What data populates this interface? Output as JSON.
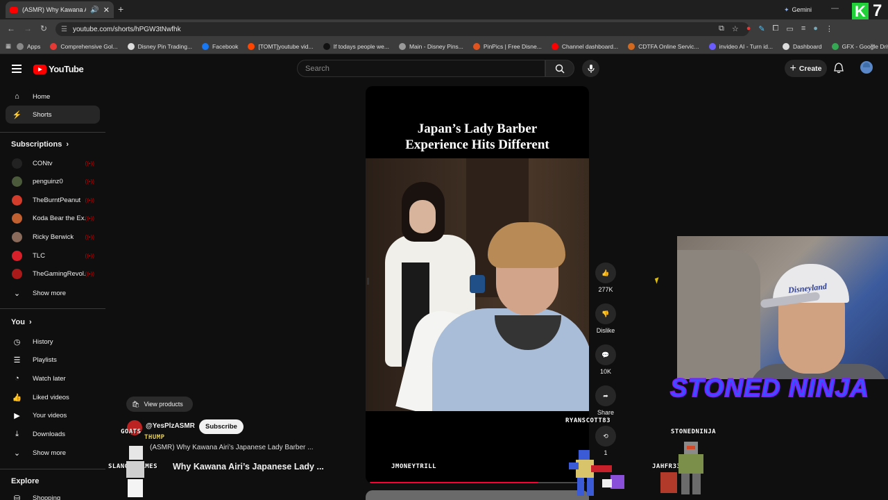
{
  "browser": {
    "tab_title": "(ASMR) Why Kawana Ai",
    "new_tab": "+",
    "url": "youtube.com/shorts/hPGW3tNwfhk",
    "gemini_label": "Gemini",
    "corner_badge": "K",
    "corner_number": "7",
    "bookmarks": [
      {
        "label": "Apps",
        "color": "#888888"
      },
      {
        "label": "Comprehensive Gol...",
        "color": "#e53935"
      },
      {
        "label": "Disney Pin Trading...",
        "color": "#dddddd"
      },
      {
        "label": "Facebook",
        "color": "#1877f2"
      },
      {
        "label": "[TOMT]youtube vid...",
        "color": "#ff4500"
      },
      {
        "label": "If todays people we...",
        "color": "#111111"
      },
      {
        "label": "Main - Disney Pins...",
        "color": "#999999"
      },
      {
        "label": "PinPics | Free Disne...",
        "color": "#e0531f"
      },
      {
        "label": "Channel dashboard...",
        "color": "#ff0000"
      },
      {
        "label": "CDTFA Online Servic...",
        "color": "#d2691e"
      },
      {
        "label": "invideo AI - Turn id...",
        "color": "#6b5cff"
      },
      {
        "label": "Dashboard",
        "color": "#dddddd"
      },
      {
        "label": "GFX - Google Drive",
        "color": "#34a853"
      }
    ]
  },
  "youtube": {
    "logo_text": "YouTube",
    "search_placeholder": "Search",
    "create_label": "Create"
  },
  "sidebar": {
    "home": "Home",
    "shorts": "Shorts",
    "subscriptions": "Subscriptions",
    "subs": [
      {
        "name": "CONtv",
        "color": "#222222"
      },
      {
        "name": "penguinz0",
        "color": "#4a5a3a"
      },
      {
        "name": "TheBurntPeanut",
        "color": "#d23c2a"
      },
      {
        "name": "Koda Bear the Ex...",
        "color": "#c06030"
      },
      {
        "name": "Ricky Berwick",
        "color": "#8a6a5a"
      },
      {
        "name": "TLC",
        "color": "#d8202a"
      },
      {
        "name": "TheGamingRevol...",
        "color": "#aa1a1a"
      }
    ],
    "show_more_1": "Show more",
    "you": "You",
    "you_items": [
      "History",
      "Playlists",
      "Watch later",
      "Liked videos",
      "Your videos",
      "Downloads"
    ],
    "show_more_2": "Show more",
    "explore": "Explore",
    "shopping": "Shopping"
  },
  "short": {
    "title_line1": "Japan’s Lady Barber",
    "title_line2": "Experience Hits Different",
    "likes": "277K",
    "dislike": "Dislike",
    "comments": "10K",
    "share": "Share",
    "remix_count": "1",
    "progress": 0.78,
    "view_products": "View products",
    "channel": "@YesPlzASMR",
    "subscribe": "Subscribe",
    "caption_small": "(ASMR) Why Kawana Airi’s Japanese Lady Barber ...",
    "caption_big": "Why Kawana Airi’s Japanese Lady ..."
  },
  "stream_overlay": {
    "webcam_brand": "Disneyland",
    "streamer_title": "STONED NINJA",
    "names": {
      "ryanscott": "RYANSCOTT83",
      "stonedninja": "STONEDNINJA",
      "goats": "GOATS",
      "slanging": "SLANGINGAMES",
      "jmoney": "JMONEYTRILL",
      "jahfr": "JAHFR33",
      "thump": "THUMP"
    }
  }
}
